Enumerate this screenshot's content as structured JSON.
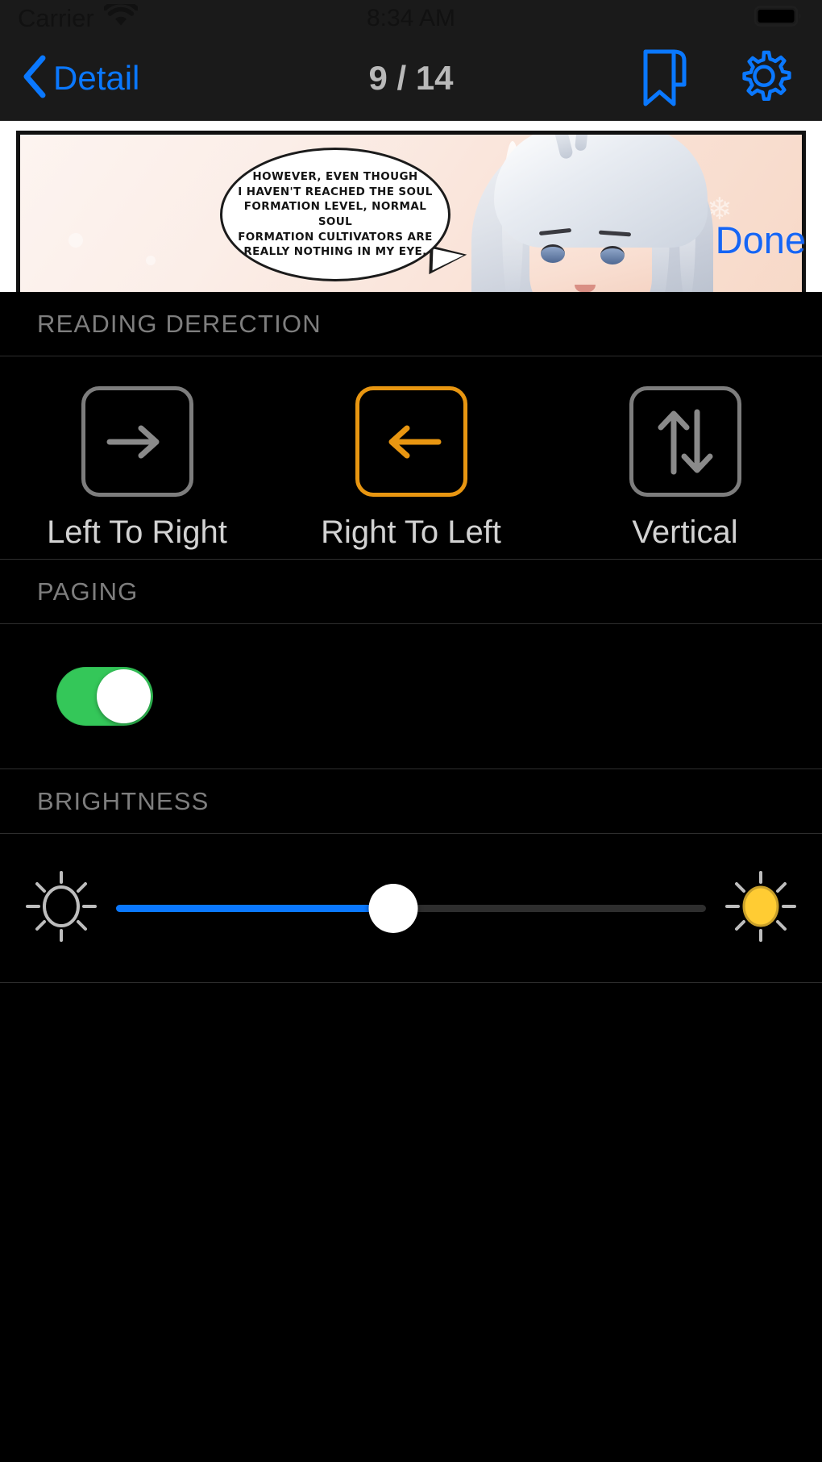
{
  "status_bar": {
    "carrier": "Carrier",
    "wifi_icon": "wifi-icon",
    "time": "8:34 AM",
    "battery_icon": "battery-full-icon"
  },
  "nav_bar": {
    "back_icon": "chevron-left-icon",
    "back_label": "Detail",
    "title": "9 / 14",
    "current_page": 9,
    "total_pages": 14,
    "bookmark_icon": "bookmark-icon",
    "settings_icon": "gear-icon"
  },
  "page_preview": {
    "speech_bubble_text": "HOWEVER, EVEN THOUGH\nI HAVEN'T REACHED THE SOUL\nFORMATION LEVEL, NORMAL SOUL\nFORMATION CULTIVATORS ARE\nREALLY NOTHING IN MY EYE.",
    "done_label": "Done"
  },
  "settings": {
    "reading_direction": {
      "header": "READING DERECTION",
      "selected": "Right To Left",
      "options": [
        {
          "label": "Left To Right",
          "icon": "arrow-right-icon",
          "selected": false
        },
        {
          "label": "Right To Left",
          "icon": "arrow-left-icon",
          "selected": true
        },
        {
          "label": "Vertical",
          "icon": "arrow-up-down-icon",
          "selected": false
        }
      ]
    },
    "paging": {
      "header": "PAGING",
      "enabled": true,
      "toggle_state": "on"
    },
    "brightness": {
      "header": "BRIGHTNESS",
      "value_percent": 47,
      "min_icon": "sun-dim-icon",
      "max_icon": "sun-bright-icon"
    }
  },
  "colors": {
    "accent_blue": "#0a78ff",
    "selected_orange": "#e89611",
    "switch_green": "#34c759",
    "done_blue": "#1565f5",
    "header_gray": "#7e7e7e"
  }
}
